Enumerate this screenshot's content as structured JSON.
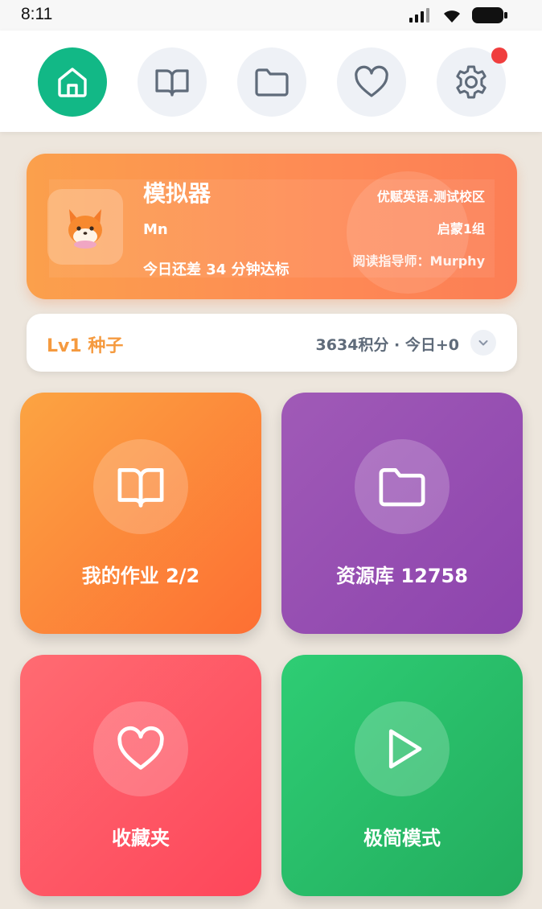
{
  "status_bar": {
    "time": "8:11"
  },
  "nav": {
    "items": [
      {
        "icon": "home-icon",
        "active": true
      },
      {
        "icon": "book-icon",
        "active": false
      },
      {
        "icon": "folder-icon",
        "active": false
      },
      {
        "icon": "heart-icon",
        "active": false
      },
      {
        "icon": "gear-icon",
        "active": false,
        "badge": true
      }
    ],
    "colors": {
      "active_bg": "#12b886",
      "inactive_bg": "#eef1f6",
      "icon": "#5f6b7a",
      "badge": "#f03e3e"
    }
  },
  "profile": {
    "name": "模拟器",
    "username": "Mn",
    "progress_text": "今日还差 34 分钟达标",
    "school": "优赋英语.测试校区",
    "group": "启蒙1组",
    "teacher": "阅读指导师：Murphy",
    "avatar_icon": "fox-avatar-icon"
  },
  "level": {
    "label": "Lv1 种子",
    "points": "3634积分 · 今日+0",
    "accent": "#f59a3f"
  },
  "tiles": [
    {
      "label": "我的作业 2/2",
      "icon": "book-icon",
      "color": "#fd6f33"
    },
    {
      "label": "资源库 12758",
      "icon": "folder-icon",
      "color": "#8d44ad"
    },
    {
      "label": "收藏夹",
      "icon": "heart-icon",
      "color": "#fe465a"
    },
    {
      "label": "极简模式",
      "icon": "play-icon",
      "color": "#23ad5e"
    }
  ]
}
